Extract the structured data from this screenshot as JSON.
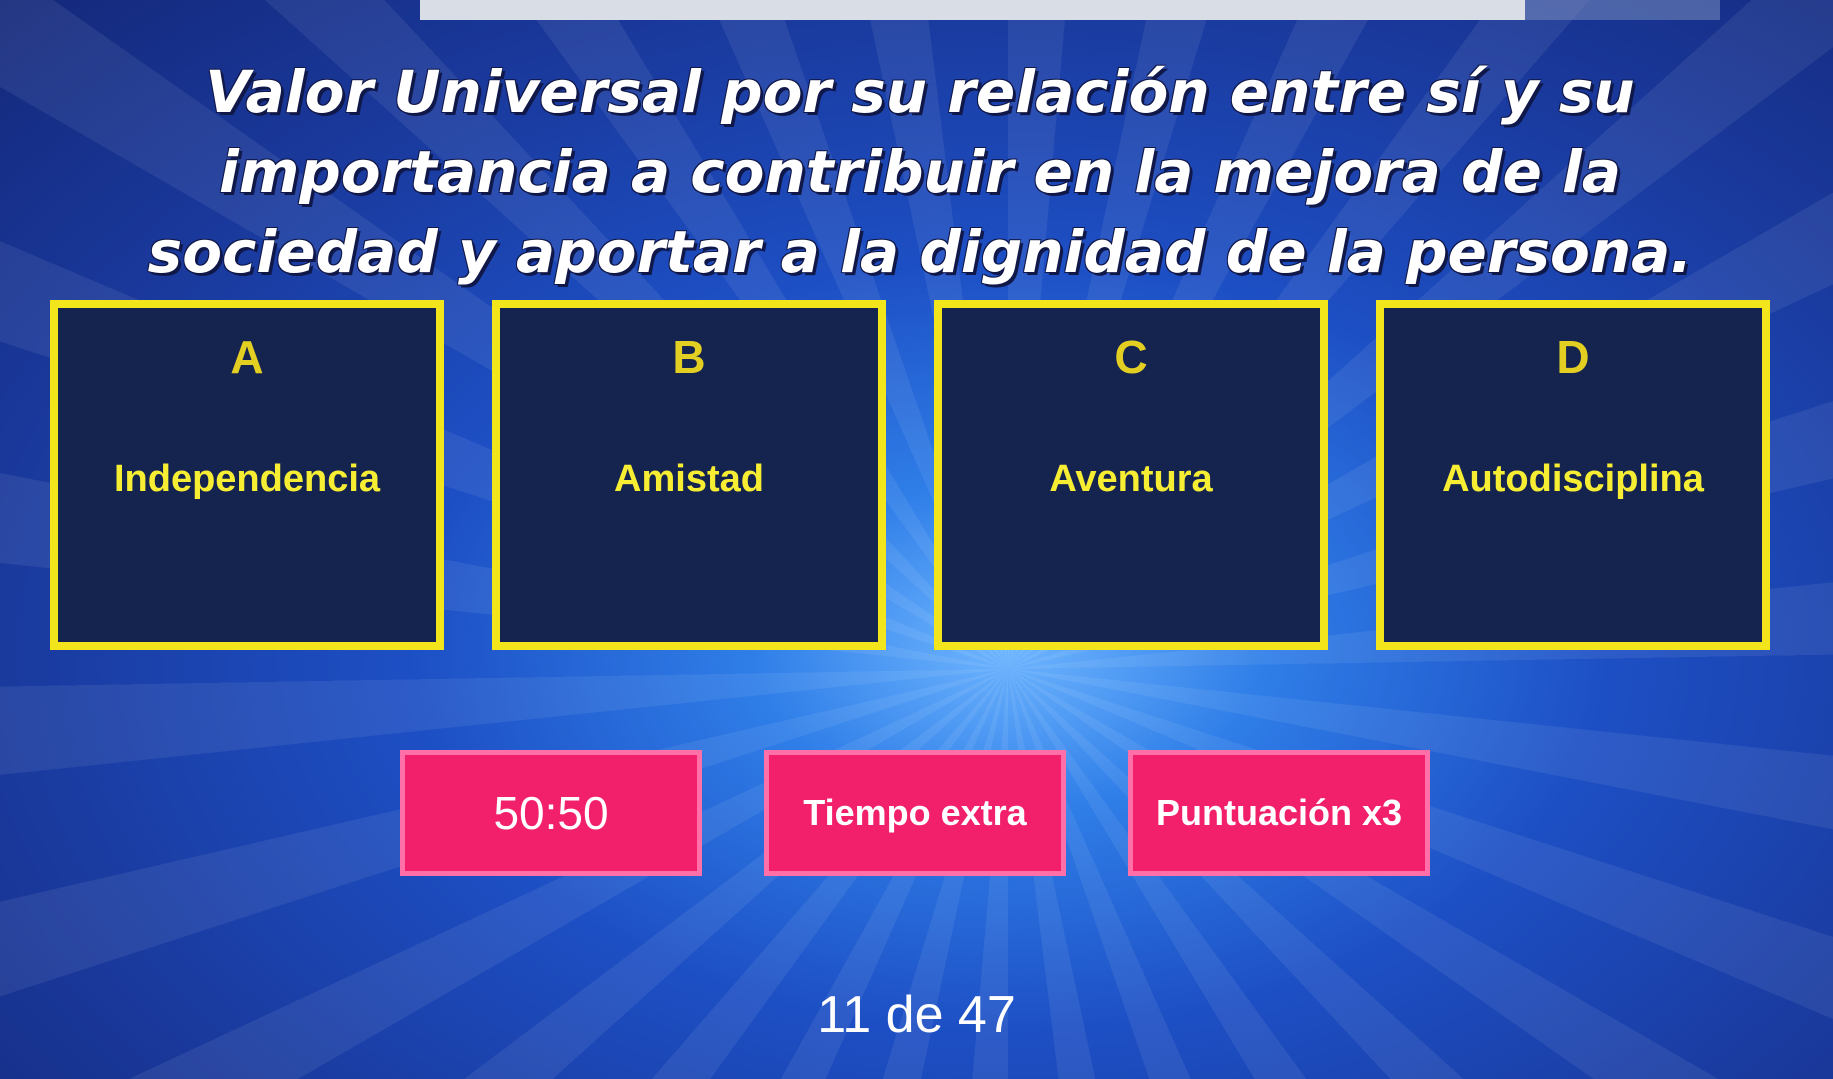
{
  "progress": {
    "fraction": 0.85
  },
  "question": {
    "text": "Valor Universal por su relación entre sí y su importancia a contribuir en la mejora de la sociedad y aportar a la dignidad de la persona."
  },
  "answers": [
    {
      "letter": "A",
      "text": "Independencia"
    },
    {
      "letter": "B",
      "text": "Amistad"
    },
    {
      "letter": "C",
      "text": "Aventura"
    },
    {
      "letter": "D",
      "text": "Autodisciplina"
    }
  ],
  "powerups": {
    "fifty_fifty": "50:50",
    "extra_time": "Tiempo extra",
    "triple_score": "Puntuación x3"
  },
  "counter": {
    "text": "11 de 47"
  },
  "colors": {
    "answer_border": "#f2e51c",
    "answer_bg": "#15234f",
    "powerup_bg": "#f21f6b",
    "background": "#1d4fc4"
  }
}
